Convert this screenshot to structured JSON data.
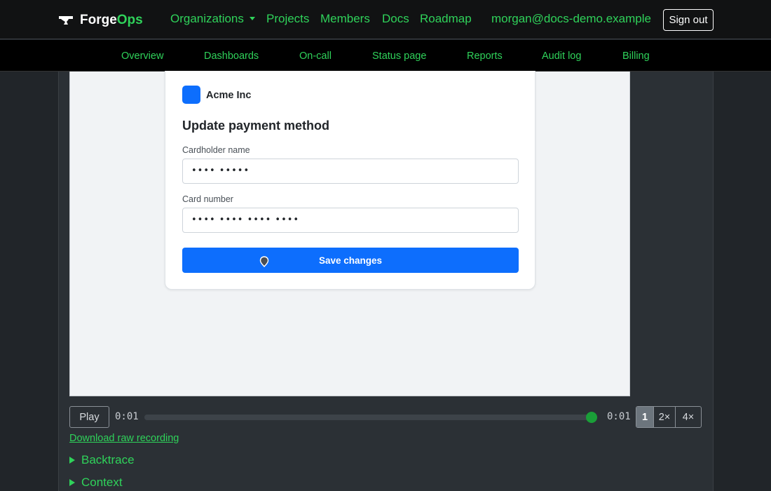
{
  "topnav": {
    "brand_part1": "Forge",
    "brand_part2": "Ops",
    "links": [
      "Organizations",
      "Projects",
      "Members",
      "Docs",
      "Roadmap"
    ],
    "user_email": "morgan@docs-demo.example",
    "sign_out": "Sign out"
  },
  "subnav": {
    "items": [
      "Overview",
      "Dashboards",
      "On-call",
      "Status page",
      "Reports",
      "Audit log",
      "Billing"
    ]
  },
  "replay": {
    "org_name": "Acme Inc",
    "title": "Update payment method",
    "cardholder_label": "Cardholder name",
    "cardholder_value": "•••• •••••",
    "card_number_label": "Card number",
    "card_number_value": "•••• •••• •••• ••••",
    "save_button": "Save changes"
  },
  "player": {
    "play_label": "Play",
    "current_time": "0:01",
    "total_time": "0:01",
    "progress": 1.0,
    "speeds": [
      "1",
      "2×",
      "4×"
    ],
    "active_speed": "1"
  },
  "download_link": "Download raw recording",
  "sections": [
    "Backtrace",
    "Context"
  ],
  "colors": {
    "accent_green": "#2fd25a",
    "primary_blue": "#0d6efd",
    "thumb_green": "#1a9e38"
  }
}
